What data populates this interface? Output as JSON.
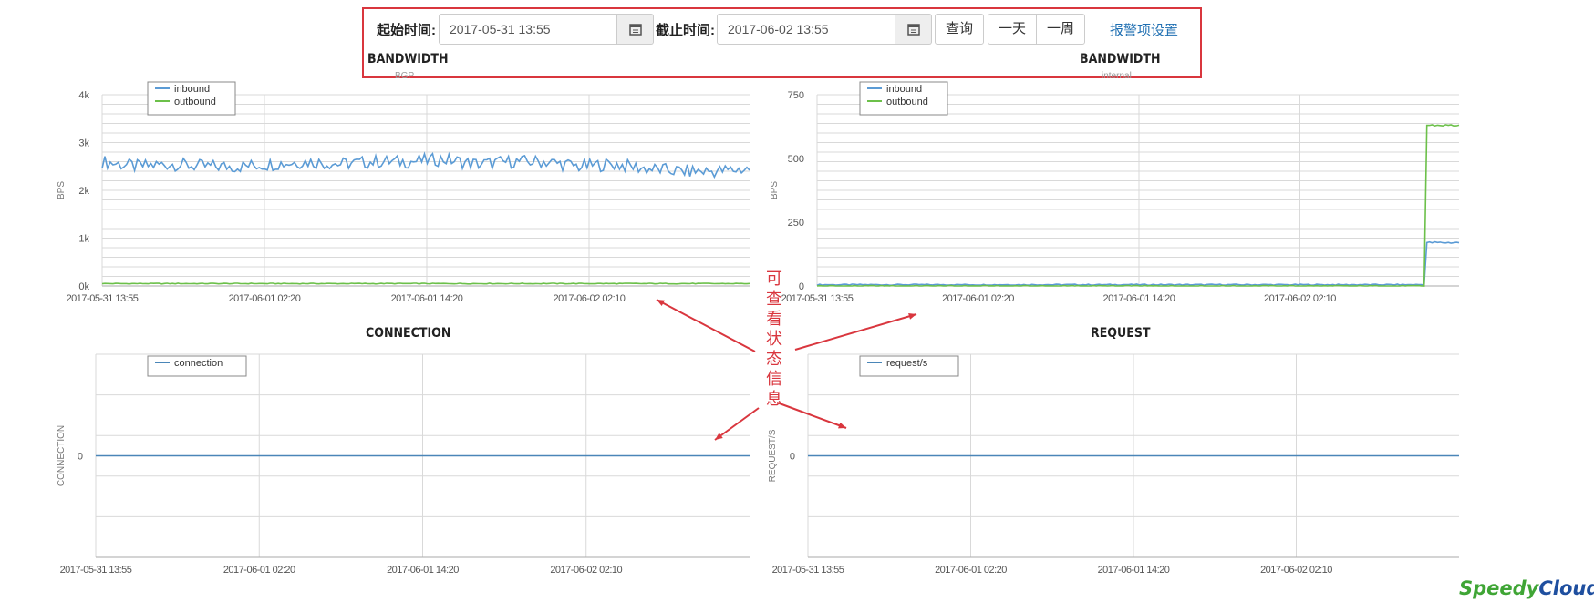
{
  "toolbar": {
    "start_label": "起始时间:",
    "start_value": "2017-05-31 13:55",
    "end_label": "截止时间:",
    "end_value": "2017-06-02 13:55",
    "query_button": "查询",
    "one_day_button": "一天",
    "one_week_button": "一周",
    "alarm_settings_link": "报警项设置"
  },
  "annotation": {
    "text": "可查看状态信息",
    "color": "#d9363e"
  },
  "logo": {
    "speedy": "Speedy",
    "cloud": "Cloud",
    "mark": "®"
  },
  "colors": {
    "inbound": "#5b9bd5",
    "outbound": "#6cc04a",
    "connection": "#4a86b8",
    "grid": "#d9d9d9",
    "frame": "#d9363e"
  },
  "chart_data": [
    {
      "type": "line",
      "title": "BANDWIDTH",
      "subtitle": "BGP",
      "ylabel": "BPS",
      "x": [
        "2017-05-31 13:55",
        "2017-06-01 02:20",
        "2017-06-01 14:20",
        "2017-06-02 02:10"
      ],
      "yticks": [
        "0k",
        "1k",
        "2k",
        "3k",
        "4k"
      ],
      "ylim": [
        0,
        4000
      ],
      "grid": true,
      "legend": "top-left",
      "series": [
        {
          "name": "inbound",
          "values": [
            2600,
            2500,
            2550,
            2500,
            2500,
            2550,
            2600,
            2550,
            2600,
            2600,
            2650,
            2550,
            2600,
            2600,
            2500,
            2550,
            2450,
            2400,
            2400,
            2450
          ]
        },
        {
          "name": "outbound",
          "values": [
            50,
            50,
            50,
            50,
            50,
            50,
            50,
            50,
            50,
            50,
            50,
            50,
            50,
            50,
            50,
            50,
            50,
            50,
            50,
            50
          ]
        }
      ]
    },
    {
      "type": "line",
      "title": "BANDWIDTH",
      "subtitle": "internal",
      "ylabel": "BPS",
      "x": [
        "2017-05-31 13:55",
        "2017-06-01 02:20",
        "2017-06-01 14:20",
        "2017-06-02 02:10"
      ],
      "yticks": [
        "0",
        "250",
        "500",
        "750"
      ],
      "ylim": [
        0,
        750
      ],
      "grid": true,
      "legend": "top-left",
      "series": [
        {
          "name": "inbound",
          "values": [
            5,
            5,
            5,
            5,
            5,
            5,
            5,
            5,
            5,
            5,
            5,
            5,
            5,
            5,
            5,
            5,
            5,
            5,
            170,
            170
          ]
        },
        {
          "name": "outbound",
          "values": [
            0,
            0,
            0,
            0,
            0,
            0,
            0,
            0,
            0,
            0,
            0,
            0,
            0,
            0,
            0,
            0,
            0,
            0,
            630,
            630
          ]
        }
      ]
    },
    {
      "type": "line",
      "title": "CONNECTION",
      "ylabel": "CONNECTION",
      "x": [
        "2017-05-31 13:55",
        "2017-06-01 02:20",
        "2017-06-01 14:20",
        "2017-06-02 02:10"
      ],
      "yticks": [
        "0"
      ],
      "grid": true,
      "legend": "top-left",
      "series": [
        {
          "name": "connection",
          "values": [
            0,
            0,
            0,
            0,
            0
          ]
        }
      ]
    },
    {
      "type": "line",
      "title": "REQUEST",
      "ylabel": "REQUEST/S",
      "x": [
        "2017-05-31 13:55",
        "2017-06-01 02:20",
        "2017-06-01 14:20",
        "2017-06-02 02:10"
      ],
      "yticks": [
        "0"
      ],
      "grid": true,
      "legend": "top-left",
      "series": [
        {
          "name": "request/s",
          "values": [
            0,
            0,
            0,
            0,
            0
          ]
        }
      ]
    }
  ]
}
